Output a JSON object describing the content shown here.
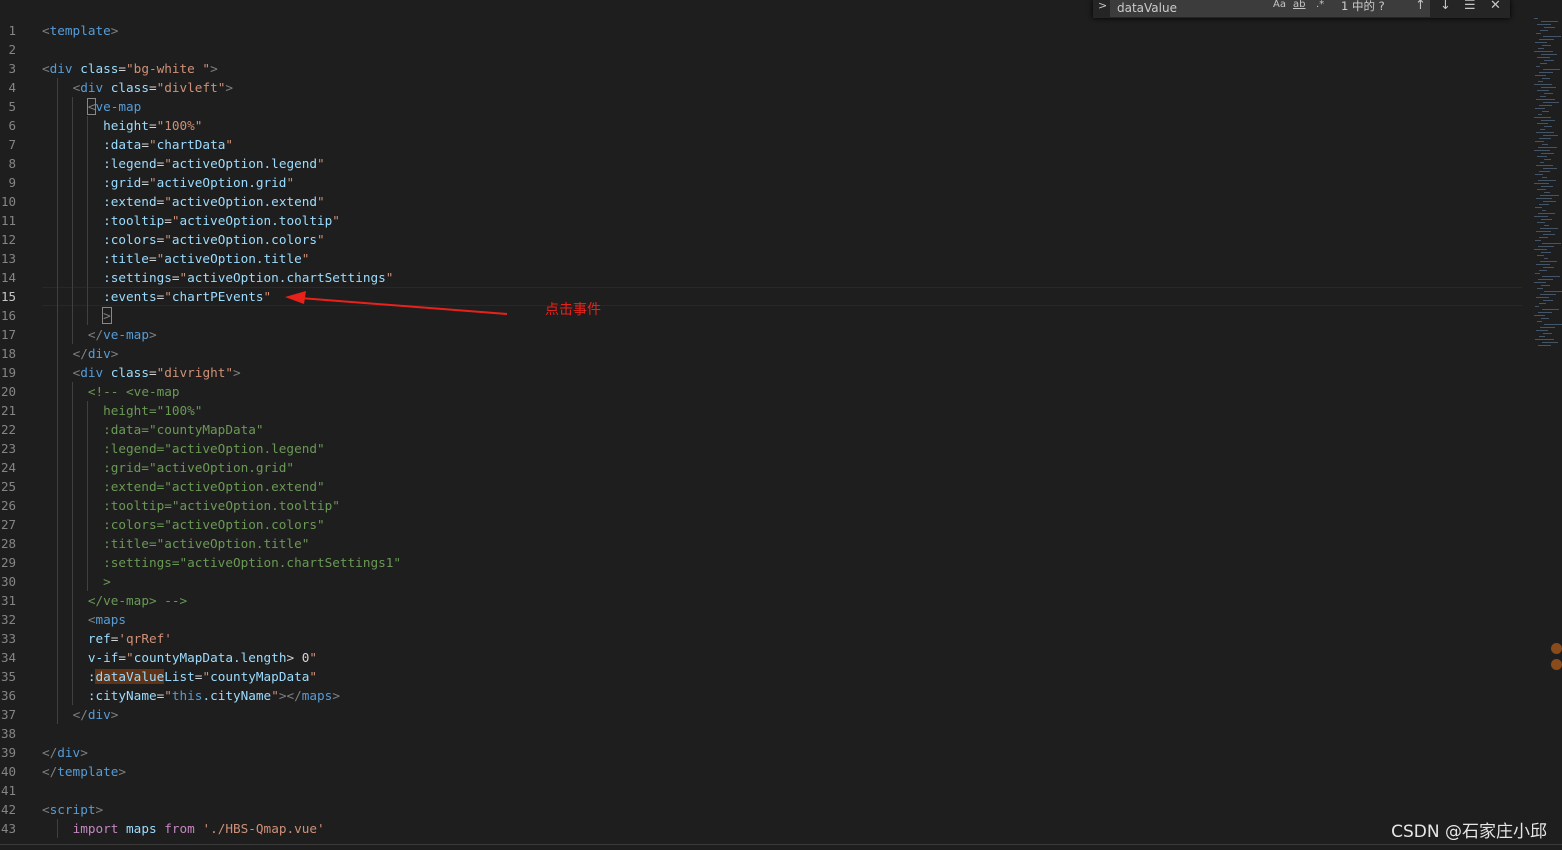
{
  "find": {
    "query": "dataValue",
    "toggle_label": ">",
    "match_case_label": "Aa",
    "whole_word_label": "ab",
    "regex_label": ".*",
    "status": "1 中的 ?",
    "prev_label": "↑",
    "next_label": "↓",
    "selection_label": "☰",
    "close_label": "✕"
  },
  "annotation": {
    "text": "点击事件"
  },
  "watermark": "CSDN @石家庄小邱",
  "colors": {
    "background": "#1e1e1e",
    "tag": "#569cd6",
    "attribute": "#9cdcfe",
    "string": "#ce9178",
    "comment": "#6a9955",
    "keyword": "#c586c0",
    "annotation": "#e8221b",
    "find_highlight": "#613214"
  },
  "current_line": 15,
  "lines": [
    {
      "n": "1",
      "tokens": [
        [
          "t-punct",
          "<"
        ],
        [
          "t-tag",
          "template"
        ],
        [
          "t-punct",
          ">"
        ]
      ]
    },
    {
      "n": "2",
      "tokens": []
    },
    {
      "n": "3",
      "tokens": [
        [
          "t-punct",
          "<"
        ],
        [
          "t-tag",
          "div"
        ],
        [
          "t-plain",
          " "
        ],
        [
          "t-attr",
          "class"
        ],
        [
          "t-plain",
          "="
        ],
        [
          "t-str",
          "\"bg-white \""
        ],
        [
          "t-punct",
          ">"
        ]
      ]
    },
    {
      "n": "4",
      "tokens": [
        [
          "t-plain",
          "    "
        ],
        [
          "t-punct",
          "<"
        ],
        [
          "t-tag",
          "div"
        ],
        [
          "t-plain",
          " "
        ],
        [
          "t-attr",
          "class"
        ],
        [
          "t-plain",
          "="
        ],
        [
          "t-str",
          "\"divleft\""
        ],
        [
          "t-punct",
          ">"
        ]
      ]
    },
    {
      "n": "5",
      "tokens": [
        [
          "t-plain",
          "      "
        ],
        [
          "t-punct bracket-box",
          "<"
        ],
        [
          "t-tag",
          "ve-map"
        ]
      ]
    },
    {
      "n": "6",
      "tokens": [
        [
          "t-plain",
          "        "
        ],
        [
          "t-attr",
          "height"
        ],
        [
          "t-plain",
          "="
        ],
        [
          "t-str",
          "\"100%\""
        ]
      ]
    },
    {
      "n": "7",
      "tokens": [
        [
          "t-plain",
          "        "
        ],
        [
          "t-attr",
          ":data"
        ],
        [
          "t-plain",
          "="
        ],
        [
          "t-str",
          "\""
        ],
        [
          "t-var",
          "chartData"
        ],
        [
          "t-str",
          "\""
        ]
      ]
    },
    {
      "n": "8",
      "tokens": [
        [
          "t-plain",
          "        "
        ],
        [
          "t-attr",
          ":legend"
        ],
        [
          "t-plain",
          "="
        ],
        [
          "t-str",
          "\""
        ],
        [
          "t-var",
          "activeOption.legend"
        ],
        [
          "t-str",
          "\""
        ]
      ]
    },
    {
      "n": "9",
      "tokens": [
        [
          "t-plain",
          "        "
        ],
        [
          "t-attr",
          ":grid"
        ],
        [
          "t-plain",
          "="
        ],
        [
          "t-str",
          "\""
        ],
        [
          "t-var",
          "activeOption.grid"
        ],
        [
          "t-str",
          "\""
        ]
      ]
    },
    {
      "n": "10",
      "tokens": [
        [
          "t-plain",
          "        "
        ],
        [
          "t-attr",
          ":extend"
        ],
        [
          "t-plain",
          "="
        ],
        [
          "t-str",
          "\""
        ],
        [
          "t-var",
          "activeOption.extend"
        ],
        [
          "t-str",
          "\""
        ]
      ]
    },
    {
      "n": "11",
      "tokens": [
        [
          "t-plain",
          "        "
        ],
        [
          "t-attr",
          ":tooltip"
        ],
        [
          "t-plain",
          "="
        ],
        [
          "t-str",
          "\""
        ],
        [
          "t-var",
          "activeOption.tooltip"
        ],
        [
          "t-str",
          "\""
        ]
      ]
    },
    {
      "n": "12",
      "tokens": [
        [
          "t-plain",
          "        "
        ],
        [
          "t-attr",
          ":colors"
        ],
        [
          "t-plain",
          "="
        ],
        [
          "t-str",
          "\""
        ],
        [
          "t-var",
          "activeOption.colors"
        ],
        [
          "t-str",
          "\""
        ]
      ]
    },
    {
      "n": "13",
      "tokens": [
        [
          "t-plain",
          "        "
        ],
        [
          "t-attr",
          ":title"
        ],
        [
          "t-plain",
          "="
        ],
        [
          "t-str",
          "\""
        ],
        [
          "t-var",
          "activeOption.title"
        ],
        [
          "t-str",
          "\""
        ]
      ]
    },
    {
      "n": "14",
      "tokens": [
        [
          "t-plain",
          "        "
        ],
        [
          "t-attr",
          ":settings"
        ],
        [
          "t-plain",
          "="
        ],
        [
          "t-str",
          "\""
        ],
        [
          "t-var",
          "activeOption.chartSettings"
        ],
        [
          "t-str",
          "\""
        ]
      ]
    },
    {
      "n": "15",
      "tokens": [
        [
          "t-plain",
          "        "
        ],
        [
          "t-attr",
          ":events"
        ],
        [
          "t-plain",
          "="
        ],
        [
          "t-str",
          "\""
        ],
        [
          "t-var",
          "chartPEvents"
        ],
        [
          "t-str",
          "\""
        ]
      ]
    },
    {
      "n": "16",
      "tokens": [
        [
          "t-plain",
          "        "
        ],
        [
          "t-punct bracket-box",
          ">"
        ]
      ]
    },
    {
      "n": "17",
      "tokens": [
        [
          "t-plain",
          "      "
        ],
        [
          "t-punct",
          "</"
        ],
        [
          "t-tag",
          "ve-map"
        ],
        [
          "t-punct",
          ">"
        ]
      ]
    },
    {
      "n": "18",
      "tokens": [
        [
          "t-plain",
          "    "
        ],
        [
          "t-punct",
          "</"
        ],
        [
          "t-tag",
          "div"
        ],
        [
          "t-punct",
          ">"
        ]
      ]
    },
    {
      "n": "19",
      "tokens": [
        [
          "t-plain",
          "    "
        ],
        [
          "t-punct",
          "<"
        ],
        [
          "t-tag",
          "div"
        ],
        [
          "t-plain",
          " "
        ],
        [
          "t-attr",
          "class"
        ],
        [
          "t-plain",
          "="
        ],
        [
          "t-str",
          "\"divright\""
        ],
        [
          "t-punct",
          ">"
        ]
      ]
    },
    {
      "n": "20",
      "tokens": [
        [
          "t-plain",
          "      "
        ],
        [
          "t-com",
          "<!-- <ve-map"
        ]
      ]
    },
    {
      "n": "21",
      "tokens": [
        [
          "t-plain",
          "        "
        ],
        [
          "t-com",
          "height=\"100%\""
        ]
      ]
    },
    {
      "n": "22",
      "tokens": [
        [
          "t-plain",
          "        "
        ],
        [
          "t-com",
          ":data=\"countyMapData\""
        ]
      ]
    },
    {
      "n": "23",
      "tokens": [
        [
          "t-plain",
          "        "
        ],
        [
          "t-com",
          ":legend=\"activeOption.legend\""
        ]
      ]
    },
    {
      "n": "24",
      "tokens": [
        [
          "t-plain",
          "        "
        ],
        [
          "t-com",
          ":grid=\"activeOption.grid\""
        ]
      ]
    },
    {
      "n": "25",
      "tokens": [
        [
          "t-plain",
          "        "
        ],
        [
          "t-com",
          ":extend=\"activeOption.extend\""
        ]
      ]
    },
    {
      "n": "26",
      "tokens": [
        [
          "t-plain",
          "        "
        ],
        [
          "t-com",
          ":tooltip=\"activeOption.tooltip\""
        ]
      ]
    },
    {
      "n": "27",
      "tokens": [
        [
          "t-plain",
          "        "
        ],
        [
          "t-com",
          ":colors=\"activeOption.colors\""
        ]
      ]
    },
    {
      "n": "28",
      "tokens": [
        [
          "t-plain",
          "        "
        ],
        [
          "t-com",
          ":title=\"activeOption.title\""
        ]
      ]
    },
    {
      "n": "29",
      "tokens": [
        [
          "t-plain",
          "        "
        ],
        [
          "t-com",
          ":settings=\"activeOption.chartSettings1\""
        ]
      ]
    },
    {
      "n": "30",
      "tokens": [
        [
          "t-plain",
          "        "
        ],
        [
          "t-com",
          ">"
        ]
      ]
    },
    {
      "n": "31",
      "tokens": [
        [
          "t-plain",
          "      "
        ],
        [
          "t-com",
          "</ve-map> -->"
        ]
      ]
    },
    {
      "n": "32",
      "tokens": [
        [
          "t-plain",
          "      "
        ],
        [
          "t-punct",
          "<"
        ],
        [
          "t-tag",
          "maps"
        ]
      ]
    },
    {
      "n": "33",
      "tokens": [
        [
          "t-plain",
          "      "
        ],
        [
          "t-attr",
          "ref"
        ],
        [
          "t-plain",
          "="
        ],
        [
          "t-str",
          "'qrRef'"
        ]
      ]
    },
    {
      "n": "34",
      "tokens": [
        [
          "t-plain",
          "      "
        ],
        [
          "t-attr",
          "v-if"
        ],
        [
          "t-plain",
          "="
        ],
        [
          "t-str",
          "\""
        ],
        [
          "t-var",
          "countyMapData.length"
        ],
        [
          "t-plain",
          "> 0"
        ],
        [
          "t-str",
          "\""
        ]
      ]
    },
    {
      "n": "35",
      "tokens": [
        [
          "t-plain",
          "      "
        ],
        [
          "t-attr",
          ":"
        ],
        [
          "t-attr find-hl",
          "dataValue"
        ],
        [
          "t-attr",
          "List"
        ],
        [
          "t-plain",
          "="
        ],
        [
          "t-str",
          "\""
        ],
        [
          "t-var",
          "countyMapData"
        ],
        [
          "t-str",
          "\""
        ]
      ]
    },
    {
      "n": "36",
      "tokens": [
        [
          "t-plain",
          "      "
        ],
        [
          "t-attr",
          ":cityName"
        ],
        [
          "t-plain",
          "="
        ],
        [
          "t-str",
          "\""
        ],
        [
          "t-this",
          "this"
        ],
        [
          "t-var",
          ".cityName"
        ],
        [
          "t-str",
          "\""
        ],
        [
          "t-punct",
          "></"
        ],
        [
          "t-tag",
          "maps"
        ],
        [
          "t-punct",
          ">"
        ]
      ]
    },
    {
      "n": "37",
      "tokens": [
        [
          "t-plain",
          "    "
        ],
        [
          "t-punct",
          "</"
        ],
        [
          "t-tag",
          "div"
        ],
        [
          "t-punct",
          ">"
        ]
      ]
    },
    {
      "n": "38",
      "tokens": []
    },
    {
      "n": "39",
      "tokens": [
        [
          "t-punct",
          "</"
        ],
        [
          "t-tag",
          "div"
        ],
        [
          "t-punct",
          ">"
        ]
      ]
    },
    {
      "n": "40",
      "tokens": [
        [
          "t-punct",
          "</"
        ],
        [
          "t-tag",
          "template"
        ],
        [
          "t-punct",
          ">"
        ]
      ]
    },
    {
      "n": "41",
      "tokens": []
    },
    {
      "n": "42",
      "tokens": [
        [
          "t-punct",
          "<"
        ],
        [
          "t-tag",
          "script"
        ],
        [
          "t-punct",
          ">"
        ]
      ]
    },
    {
      "n": "43",
      "tokens": [
        [
          "t-plain",
          "    "
        ],
        [
          "t-kw",
          "import"
        ],
        [
          "t-plain",
          " "
        ],
        [
          "t-var",
          "maps"
        ],
        [
          "t-plain",
          " "
        ],
        [
          "t-kw",
          "from"
        ],
        [
          "t-plain",
          " "
        ],
        [
          "t-str",
          "'./HBS-Qmap.vue'"
        ]
      ]
    }
  ]
}
